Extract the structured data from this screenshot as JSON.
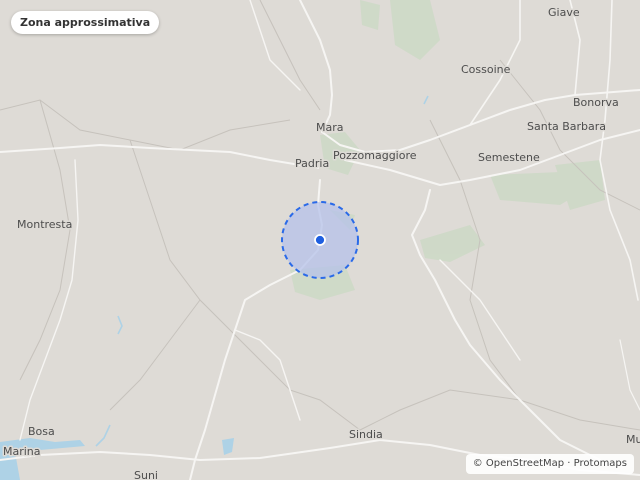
{
  "header": {
    "label": "Zona approssimativa"
  },
  "attribution": "© OpenStreetMap · Protomaps",
  "map": {
    "colors": {
      "land": "#dedbd6",
      "road": "#f5f4f2",
      "boundary": "#c9c6c1",
      "green": "#c9d9c3",
      "water": "#aed2e6",
      "area_fill": "#b8c4e8",
      "area_stroke": "#2a6ae8",
      "dot": "#1f5fe0"
    },
    "places": {
      "giave": "Giave",
      "cossoine": "Cossoine",
      "bonorva": "Bonorva",
      "santa_barbara": "Santa Barbara",
      "mara": "Mara",
      "padria": "Padria",
      "pozzomaggiore": "Pozzomaggiore",
      "semestene": "Semestene",
      "montresta": "Montresta",
      "bosa": "Bosa",
      "marina": "Marina",
      "sindia": "Sindia",
      "suni": "Suni",
      "mu": "Mu"
    }
  }
}
